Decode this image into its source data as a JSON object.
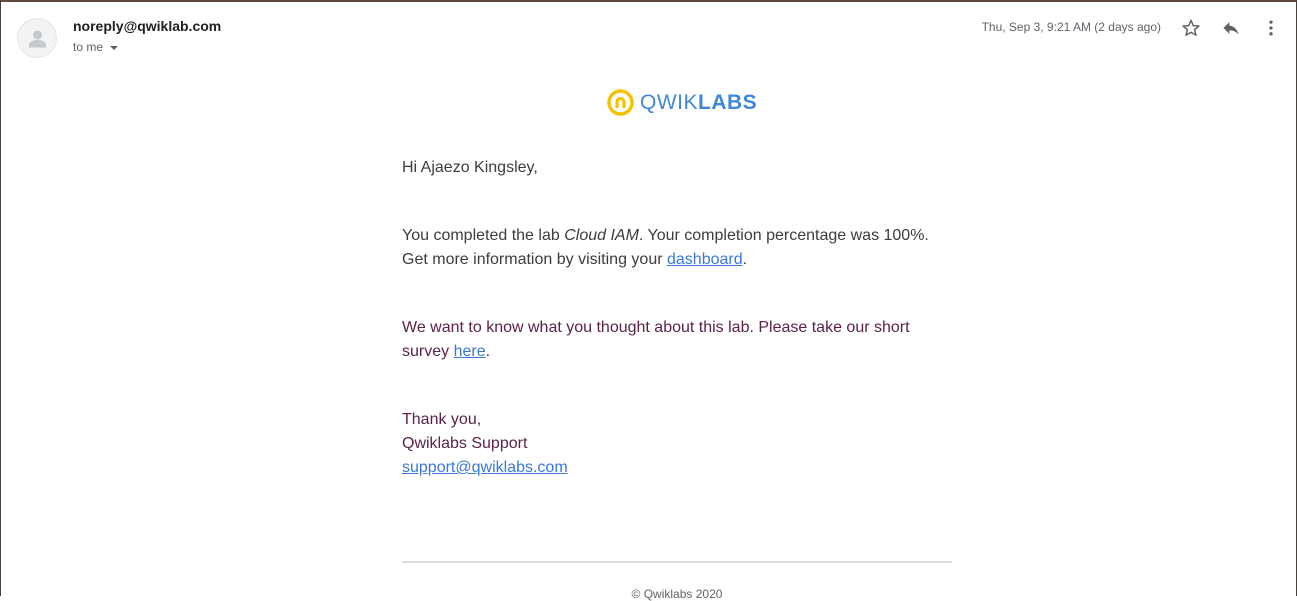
{
  "header": {
    "sender": "noreply@qwiklab.com",
    "recipient_label": "to me",
    "timestamp": "Thu, Sep 3, 9:21 AM (2 days ago)"
  },
  "icons": {
    "avatar": "person-icon",
    "star": "star-icon",
    "reply": "reply-icon",
    "more": "more-vertical-icon",
    "logo": "qwiklabs-logo-icon"
  },
  "logo": {
    "text_light": "QWIK",
    "text_bold": "LABS",
    "color": "#3f87d8",
    "mark_color": "#f4c200"
  },
  "email": {
    "greeting": "Hi Ajaezo Kingsley,",
    "completion_prefix": "You completed the lab ",
    "lab_name": "Cloud IAM",
    "completion_suffix": ". Your completion percentage was 100%.",
    "info_prefix": "Get more information by visiting your ",
    "dashboard_link": "dashboard",
    "info_suffix": ".",
    "survey_text": "We want to know what you thought about this lab. Please take our short survey ",
    "survey_link": "here",
    "survey_suffix": ".",
    "thanks": "Thank you,",
    "signature": "Qwiklabs Support",
    "support_email": "support@qwiklabs.com",
    "footer": "© Qwiklabs 2020"
  },
  "colors": {
    "link": "#3b78d8",
    "survey_text": "#5b2248",
    "body_text": "#3c3c3c"
  }
}
